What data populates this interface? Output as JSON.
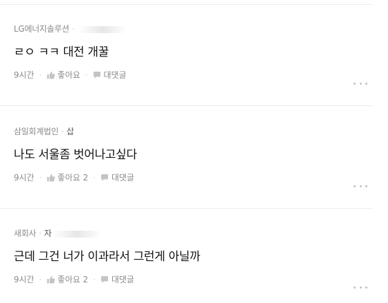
{
  "posts": [
    {
      "company": "LG에너지솔루션",
      "nickname": "",
      "title": "ㄹㅇ ㅋㅋ 대전 개꿀",
      "time": "9시간",
      "like_label": "좋아요",
      "comment_label": "대댓글"
    },
    {
      "company": "삼일회계법인",
      "nickname": "삽",
      "title": "나도 서울좀 벗어나고싶다",
      "time": "9시간",
      "like_label": "좋아요 2",
      "comment_label": "대댓글"
    },
    {
      "company": "새회사",
      "nickname": "자",
      "title": "근데 그건 너가 이과라서 그런게 아닐까",
      "time": "9시간",
      "like_label": "좋아요 2",
      "comment_label": "대댓글"
    }
  ],
  "icons": {
    "like": "thumbs-up-icon",
    "comment": "speech-bubble-icon",
    "more": "more-options-icon"
  },
  "colors": {
    "text_primary": "#111111",
    "text_meta": "#8a8a8a",
    "icon": "#c4c4c4",
    "divider": "#ececec"
  }
}
